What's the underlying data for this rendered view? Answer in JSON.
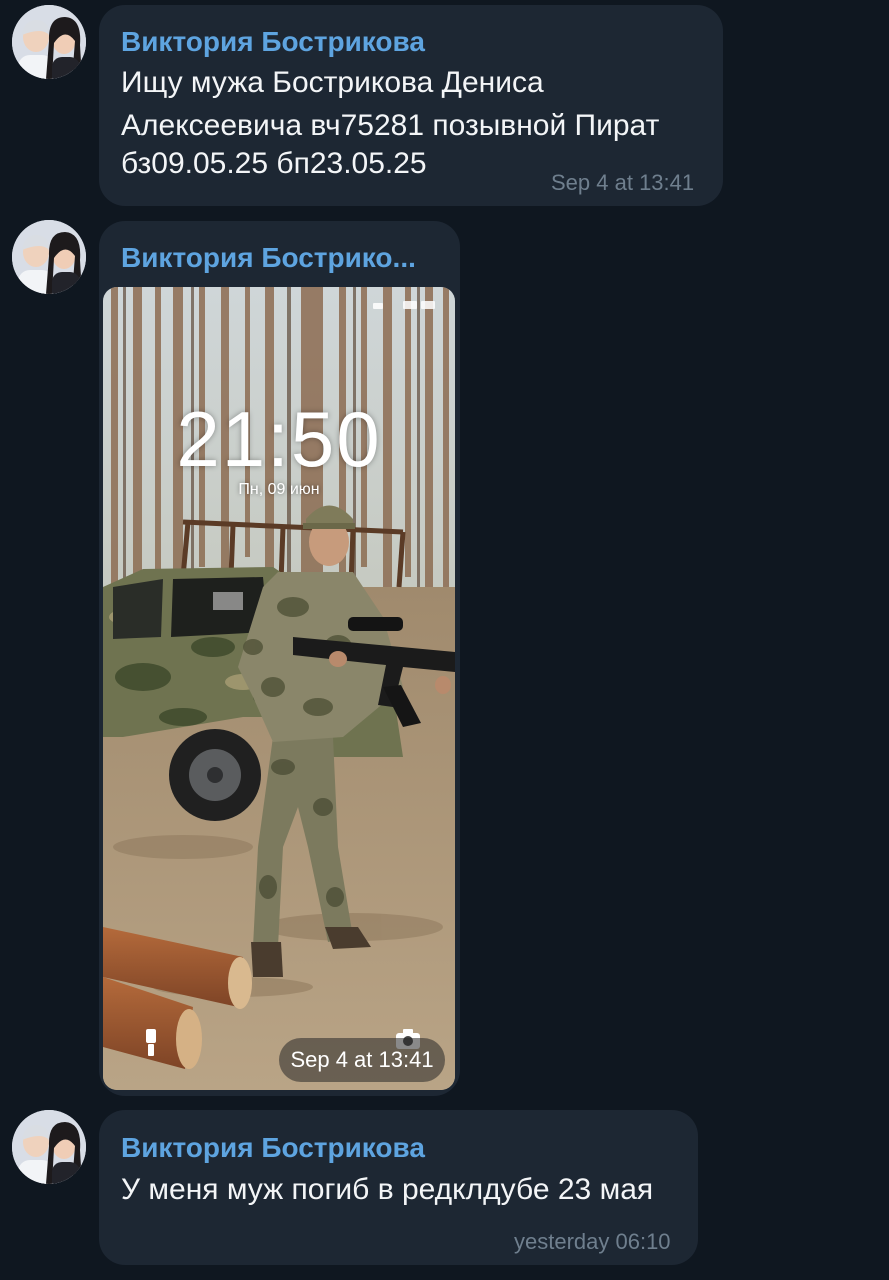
{
  "messages": [
    {
      "sender": "Виктория Бострикова",
      "lines": [
        "Ищу мужа Бострикова Дениса",
        "Алексеевича вч75281 позывной Пират",
        "бз09.05.25 бп23.05.25"
      ],
      "timestamp": "Sep 4 at 13:41"
    },
    {
      "sender": "Виктория Бострико...",
      "photo": {
        "lockscreen_time": "21:50",
        "lockscreen_date": "Пн, 09 июн",
        "icons": [
          "flashlight-icon",
          "camera-icon"
        ]
      },
      "timestamp": "Sep 4 at 13:41"
    },
    {
      "sender": "Виктория Бострикова",
      "lines": [
        "У меня муж погиб в редклдубе 23 мая"
      ],
      "timestamp": "yesterday 06:10"
    }
  ],
  "colors": {
    "background": "#0f1720",
    "bubble": "#1d2733",
    "sender_name": "#5ea4e0",
    "message_text": "#f3f5f7",
    "timestamp": "#6f7f8e"
  }
}
